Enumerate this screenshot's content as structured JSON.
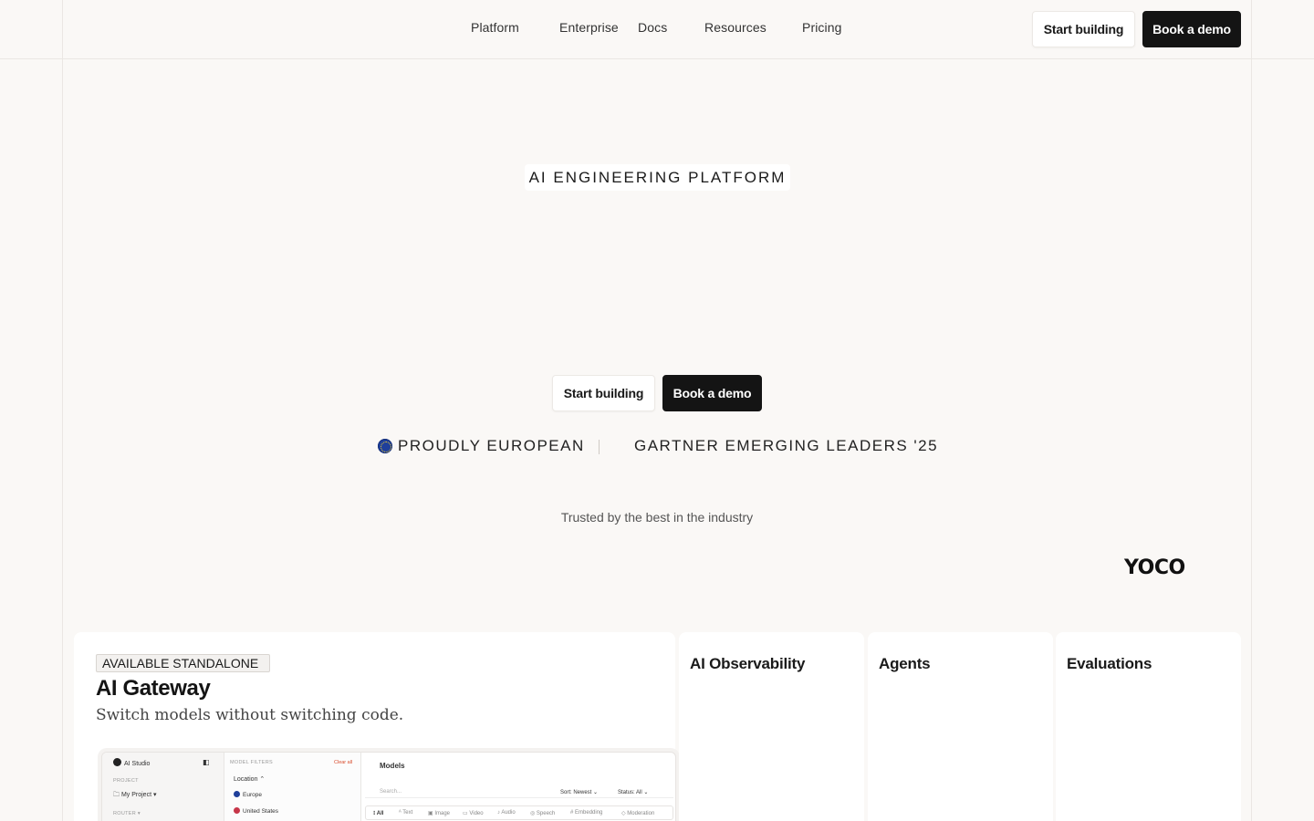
{
  "nav": {
    "links": [
      "Platform",
      "Enterprise",
      "Docs",
      "Resources",
      "Pricing"
    ],
    "start_label": "Start building",
    "demo_label": "Book a demo"
  },
  "hero": {
    "eyebrow": "AI ENGINEERING PLATFORM",
    "start_label": "Start building",
    "demo_label": "Book a demo",
    "badge_european": "PROUDLY EUROPEAN",
    "badge_gartner": "GARTNER EMERGING LEADERS '25",
    "trusted": "Trusted by the best in the industry",
    "logo_yoco": "YOCO"
  },
  "cards": {
    "gateway": {
      "tag": "AVAILABLE STANDALONE",
      "title": "AI Gateway",
      "subtitle": "Switch models without switching code."
    },
    "observability": "AI Observability",
    "agents": "Agents",
    "evaluations": "Evaluations"
  },
  "mini_app": {
    "brand": "AI Studio",
    "project_label": "PROJECT",
    "project_value": "My Project",
    "router_label": "ROUTER",
    "filters_label": "MODEL FILTERS",
    "clear_all": "Clear all",
    "location": "Location",
    "europe": "Europe",
    "united_states": "United States",
    "models_title": "Models",
    "search_placeholder": "Search...",
    "sort": "Sort: Newest",
    "status": "Status: All",
    "tabs": [
      "All",
      "Text",
      "Image",
      "Video",
      "Audio",
      "Speech",
      "Embedding",
      "Moderation"
    ]
  },
  "colors": {
    "background": "#faf8f6",
    "dark_button": "#141414",
    "eu_blue": "#1f3f9a"
  }
}
